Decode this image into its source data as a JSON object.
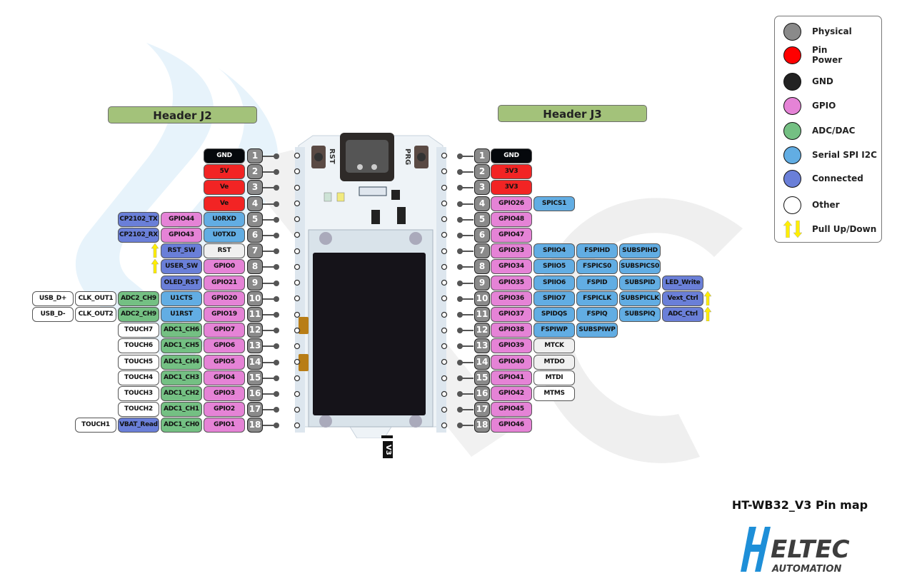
{
  "title": "HT-WB32_V3 Pin map",
  "logo": {
    "brand": "HELTEC",
    "sub": "AUTOMATION",
    "colors": {
      "blue": "#1e8fd8",
      "gray": "#3d3d3d"
    }
  },
  "headers": {
    "j2": "Header J2",
    "j3": "Header J3"
  },
  "board": {
    "buttons": [
      "RST",
      "PRG"
    ],
    "version_label": "V3"
  },
  "colors": {
    "physical": "#8a8a8a",
    "power": "#f22424",
    "gnd": "#05080c",
    "gpio": "#e583d6",
    "adc": "#74c083",
    "serial": "#62ade3",
    "connected": "#6a7fd8",
    "other": "#ffffff",
    "pull": "#ffee00"
  },
  "legend": [
    {
      "label": "Physical",
      "color": "#8a8a8a"
    },
    {
      "label": "Pin\nPower",
      "color": "#ff0000"
    },
    {
      "label": "GND",
      "color": "#222222"
    },
    {
      "label": "GPIO",
      "color": "#e583d6"
    },
    {
      "label": "ADC/DAC",
      "color": "#74c083"
    },
    {
      "label": "Serial SPI I2C",
      "color": "#62ade3"
    },
    {
      "label": "Connected",
      "color": "#6a7fd8"
    },
    {
      "label": "Other",
      "color": "#ffffff"
    },
    {
      "label": "Pull Up/Down",
      "color": "arrows"
    }
  ],
  "j2": [
    {
      "pin": "1",
      "cells": [
        {
          "t": "GND",
          "c": "gnd"
        }
      ]
    },
    {
      "pin": "2",
      "cells": [
        {
          "t": "5V",
          "c": "power"
        }
      ]
    },
    {
      "pin": "3",
      "cells": [
        {
          "t": "Ve",
          "c": "power"
        }
      ]
    },
    {
      "pin": "4",
      "cells": [
        {
          "t": "Ve",
          "c": "power"
        }
      ]
    },
    {
      "pin": "5",
      "cells": [
        {
          "t": "U0RXD",
          "c": "serial"
        },
        {
          "t": "GPIO44",
          "c": "gpio"
        },
        {
          "t": "CP2102_TX",
          "c": "conn"
        }
      ]
    },
    {
      "pin": "6",
      "cells": [
        {
          "t": "U0TXD",
          "c": "serial"
        },
        {
          "t": "GPIO43",
          "c": "gpio"
        },
        {
          "t": "CP2102_RX",
          "c": "conn"
        }
      ]
    },
    {
      "pin": "7",
      "cells": [
        {
          "t": "RST",
          "c": "other2"
        },
        {
          "t": "RST_SW",
          "c": "conn"
        }
      ],
      "pull": "up"
    },
    {
      "pin": "8",
      "cells": [
        {
          "t": "GPIO0",
          "c": "gpio"
        },
        {
          "t": "USER_SW",
          "c": "conn"
        }
      ],
      "pull": "up"
    },
    {
      "pin": "9",
      "cells": [
        {
          "t": "GPIO21",
          "c": "gpio"
        },
        {
          "t": "OLED_RST",
          "c": "conn"
        }
      ]
    },
    {
      "pin": "10",
      "cells": [
        {
          "t": "GPIO20",
          "c": "gpio"
        },
        {
          "t": "U1CTS",
          "c": "serial"
        },
        {
          "t": "ADC2_CH9",
          "c": "adc"
        },
        {
          "t": "CLK_OUT1",
          "c": "other"
        },
        {
          "t": "USB_D+",
          "c": "other"
        }
      ]
    },
    {
      "pin": "11",
      "cells": [
        {
          "t": "GPIO19",
          "c": "gpio"
        },
        {
          "t": "U1RST",
          "c": "serial"
        },
        {
          "t": "ADC2_CH9",
          "c": "adc"
        },
        {
          "t": "CLK_OUT2",
          "c": "other"
        },
        {
          "t": "USB_D-",
          "c": "other"
        }
      ]
    },
    {
      "pin": "12",
      "cells": [
        {
          "t": "GPIO7",
          "c": "gpio"
        },
        {
          "t": "ADC1_CH6",
          "c": "adc"
        },
        {
          "t": "TOUCH7",
          "c": "other"
        }
      ]
    },
    {
      "pin": "13",
      "cells": [
        {
          "t": "GPIO6",
          "c": "gpio"
        },
        {
          "t": "ADC1_CH5",
          "c": "adc"
        },
        {
          "t": "TOUCH6",
          "c": "other"
        }
      ]
    },
    {
      "pin": "14",
      "cells": [
        {
          "t": "GPIO5",
          "c": "gpio"
        },
        {
          "t": "ADC1_CH4",
          "c": "adc"
        },
        {
          "t": "TOUCH5",
          "c": "other"
        }
      ]
    },
    {
      "pin": "15",
      "cells": [
        {
          "t": "GPIO4",
          "c": "gpio"
        },
        {
          "t": "ADC1_CH3",
          "c": "adc"
        },
        {
          "t": "TOUCH4",
          "c": "other"
        }
      ]
    },
    {
      "pin": "16",
      "cells": [
        {
          "t": "GPIO3",
          "c": "gpio"
        },
        {
          "t": "ADC1_CH2",
          "c": "adc"
        },
        {
          "t": "TOUCH3",
          "c": "other"
        }
      ]
    },
    {
      "pin": "17",
      "cells": [
        {
          "t": "GPIO2",
          "c": "gpio"
        },
        {
          "t": "ADC1_CH1",
          "c": "adc"
        },
        {
          "t": "TOUCH2",
          "c": "other"
        }
      ]
    },
    {
      "pin": "18",
      "cells": [
        {
          "t": "GPIO1",
          "c": "gpio"
        },
        {
          "t": "ADC1_CH0",
          "c": "adc"
        },
        {
          "t": "VBAT_Read",
          "c": "conn"
        },
        {
          "t": "TOUCH1",
          "c": "other"
        }
      ]
    }
  ],
  "j3": [
    {
      "pin": "1",
      "cells": [
        {
          "t": "GND",
          "c": "gnd"
        }
      ]
    },
    {
      "pin": "2",
      "cells": [
        {
          "t": "3V3",
          "c": "power"
        }
      ]
    },
    {
      "pin": "3",
      "cells": [
        {
          "t": "3V3",
          "c": "power"
        }
      ]
    },
    {
      "pin": "4",
      "cells": [
        {
          "t": "GPIO26",
          "c": "gpio"
        },
        {
          "t": "SPICS1",
          "c": "serial"
        }
      ]
    },
    {
      "pin": "5",
      "cells": [
        {
          "t": "GPIO48",
          "c": "gpio"
        }
      ]
    },
    {
      "pin": "6",
      "cells": [
        {
          "t": "GPIO47",
          "c": "gpio"
        }
      ]
    },
    {
      "pin": "7",
      "cells": [
        {
          "t": "GPIO33",
          "c": "gpio"
        },
        {
          "t": "SPIIO4",
          "c": "serial"
        },
        {
          "t": "FSPIHD",
          "c": "serial"
        },
        {
          "t": "SUBSPIHD",
          "c": "serial"
        }
      ]
    },
    {
      "pin": "8",
      "cells": [
        {
          "t": "GPIO34",
          "c": "gpio"
        },
        {
          "t": "SPIIO5",
          "c": "serial"
        },
        {
          "t": "FSPICS0",
          "c": "serial"
        },
        {
          "t": "SUBSPICS0",
          "c": "serial"
        }
      ]
    },
    {
      "pin": "9",
      "cells": [
        {
          "t": "GPIO35",
          "c": "gpio"
        },
        {
          "t": "SPIIO6",
          "c": "serial"
        },
        {
          "t": "FSPID",
          "c": "serial"
        },
        {
          "t": "SUBSPID",
          "c": "serial"
        },
        {
          "t": "LED_Write",
          "c": "conn"
        }
      ]
    },
    {
      "pin": "10",
      "cells": [
        {
          "t": "GPIO36",
          "c": "gpio"
        },
        {
          "t": "SPIIO7",
          "c": "serial"
        },
        {
          "t": "FSPICLK",
          "c": "serial"
        },
        {
          "t": "SUBSPICLK",
          "c": "serial"
        },
        {
          "t": "Vext_Ctrl",
          "c": "conn"
        }
      ],
      "pull": "up"
    },
    {
      "pin": "11",
      "cells": [
        {
          "t": "GPIO37",
          "c": "gpio"
        },
        {
          "t": "SPIDQS",
          "c": "serial"
        },
        {
          "t": "FSPIQ",
          "c": "serial"
        },
        {
          "t": "SUBSPIQ",
          "c": "serial"
        },
        {
          "t": "ADC_Ctrl",
          "c": "conn"
        }
      ],
      "pull": "up"
    },
    {
      "pin": "12",
      "cells": [
        {
          "t": "GPIO38",
          "c": "gpio"
        },
        {
          "t": "FSPIWP",
          "c": "serial"
        },
        {
          "t": "SUBSPIWP",
          "c": "serial"
        }
      ]
    },
    {
      "pin": "13",
      "cells": [
        {
          "t": "GPIO39",
          "c": "gpio"
        },
        {
          "t": "MTCK",
          "c": "other2"
        }
      ]
    },
    {
      "pin": "14",
      "cells": [
        {
          "t": "GPIO40",
          "c": "gpio"
        },
        {
          "t": "MTDO",
          "c": "other2"
        }
      ]
    },
    {
      "pin": "15",
      "cells": [
        {
          "t": "GPIO41",
          "c": "gpio"
        },
        {
          "t": "MTDI",
          "c": "other"
        }
      ]
    },
    {
      "pin": "16",
      "cells": [
        {
          "t": "GPIO42",
          "c": "gpio"
        },
        {
          "t": "MTMS",
          "c": "other"
        }
      ]
    },
    {
      "pin": "17",
      "cells": [
        {
          "t": "GPIO45",
          "c": "gpio"
        }
      ]
    },
    {
      "pin": "18",
      "cells": [
        {
          "t": "GPIO46",
          "c": "gpio"
        }
      ]
    }
  ]
}
